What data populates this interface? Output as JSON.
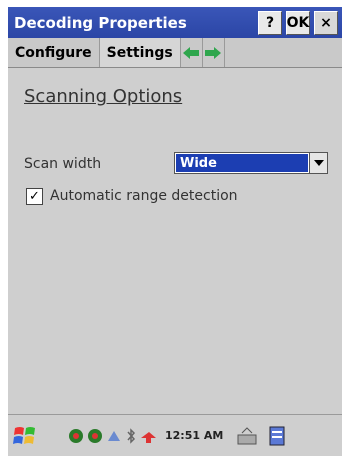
{
  "window": {
    "title": "Decoding Properties",
    "help_label": "?",
    "ok_label": "OK",
    "close_label": "×"
  },
  "tabs": [
    {
      "label": "Configure"
    },
    {
      "label": "Settings"
    }
  ],
  "content": {
    "heading": "Scanning Options",
    "scan_width": {
      "label": "Scan width",
      "value": "Wide"
    },
    "auto_range": {
      "label": "Automatic range detection",
      "checked": true,
      "check_glyph": "✓"
    }
  },
  "taskbar": {
    "clock": "12:51 AM",
    "icons": [
      "windows-start-icon",
      "network-icon",
      "sync-icon",
      "bluetooth-icon",
      "volume-icon",
      "keyboard-icon",
      "app-switch-icon"
    ]
  },
  "colors": {
    "titlebar": "#2b46a6",
    "selection": "#1c3eb2",
    "background": "#cfcfcf"
  }
}
